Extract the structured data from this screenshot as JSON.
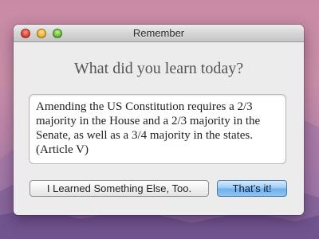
{
  "window": {
    "title": "Remember",
    "controls": {
      "close": "close-button",
      "minimize": "minimize-button",
      "zoom": "zoom-button"
    }
  },
  "main": {
    "prompt": "What did you learn today?",
    "note_text": "Amending the US Constitution requires a 2/3 majority in the House and a 2/3 majority in the Senate, as well as a 3/4 majority in the states. (Article V)"
  },
  "buttons": {
    "secondary_label": "I Learned Something Else, Too.",
    "primary_label": "That’s it!"
  },
  "colors": {
    "window_bg": "#ececec",
    "primary_button": "#8ec6f5",
    "close": "#e5453a",
    "minimize": "#f0b534",
    "zoom": "#6cc03c"
  }
}
